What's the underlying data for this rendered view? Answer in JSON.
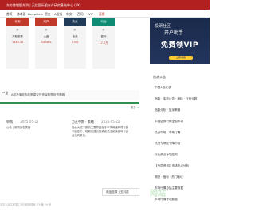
{
  "topbar": {
    "text": "东方炼钢股东消 | 天信国际股东产研究基础中心 (1K)"
  },
  "nav": [
    {
      "label": "首页",
      "active": false
    },
    {
      "label": "基本面",
      "active": false
    },
    {
      "label": "Deepview",
      "active": false
    },
    {
      "label": "资金",
      "active": false
    },
    {
      "label": "A股指",
      "active": false
    },
    {
      "label": "申文",
      "active": false
    },
    {
      "label": "百问",
      "active": false
    },
    {
      "label": "VIP",
      "active": false
    },
    {
      "label": "直播",
      "active": true
    }
  ],
  "cards": [
    {
      "title": "长安",
      "color": "#c0392b",
      "lines": [
        "个",
        "万股股票",
        "1438.33"
      ]
    },
    {
      "title": "用户",
      "color": "#c0392b",
      "lines": [
        "个",
        "大盘",
        "34.58%"
      ]
    },
    {
      "title": "热点",
      "color": "#1f3b57",
      "lines": [
        "个",
        "电池",
        "5.5%"
      ]
    },
    {
      "title": "行业",
      "color": "#0f8a73",
      "lines": [
        "个",
        "盈利",
        "17.2万"
      ]
    }
  ],
  "ad": {
    "brand": "投研社区",
    "sub": "开户助手",
    "big": "免费领VIP",
    "cta": "立即领取"
  },
  "wide": {
    "title": "一览",
    "desc": "A股净值股市政策建议外资保险是投资策略"
  },
  "more": "更多 >",
  "posts": [
    {
      "title": "申购",
      "date": "2025-05-22",
      "body": "公告 | 期货加权表格"
    },
    {
      "title": "方正中期 · 策略",
      "date": "2025-05-22",
      "body": "股价大幅下跌的主要原因在于市场情绪转弱与基本面压力，短期内建议投资者关注政策信号与资金流向变化。"
    }
  ],
  "dropdown": {
    "label": "商品选择 | 五料类"
  },
  "footer": {
    "text": "中华人民共和国工商行政管理局 ICP 备 09 号"
  },
  "sidebar": {
    "heading": "热点公告",
    "items": [
      "中国A股汇总",
      "指数 · 本市公告 · 指标 · 行行业数",
      "指数分析 · 加深策略",
      "中国证券行情全国市场",
      "热点市场 · 市场行情",
      "热门专项区下降市场",
      "行业热点专项结构",
      "【专项资讯】市场热点分析",
      "期货 · 指标 · 热门版块",
      "市场行情总结主要数据",
      "市场行情专项数据"
    ]
  },
  "watermark": "网站",
  "colors": {
    "primary": "#b22020",
    "green": "#2f8f55"
  }
}
